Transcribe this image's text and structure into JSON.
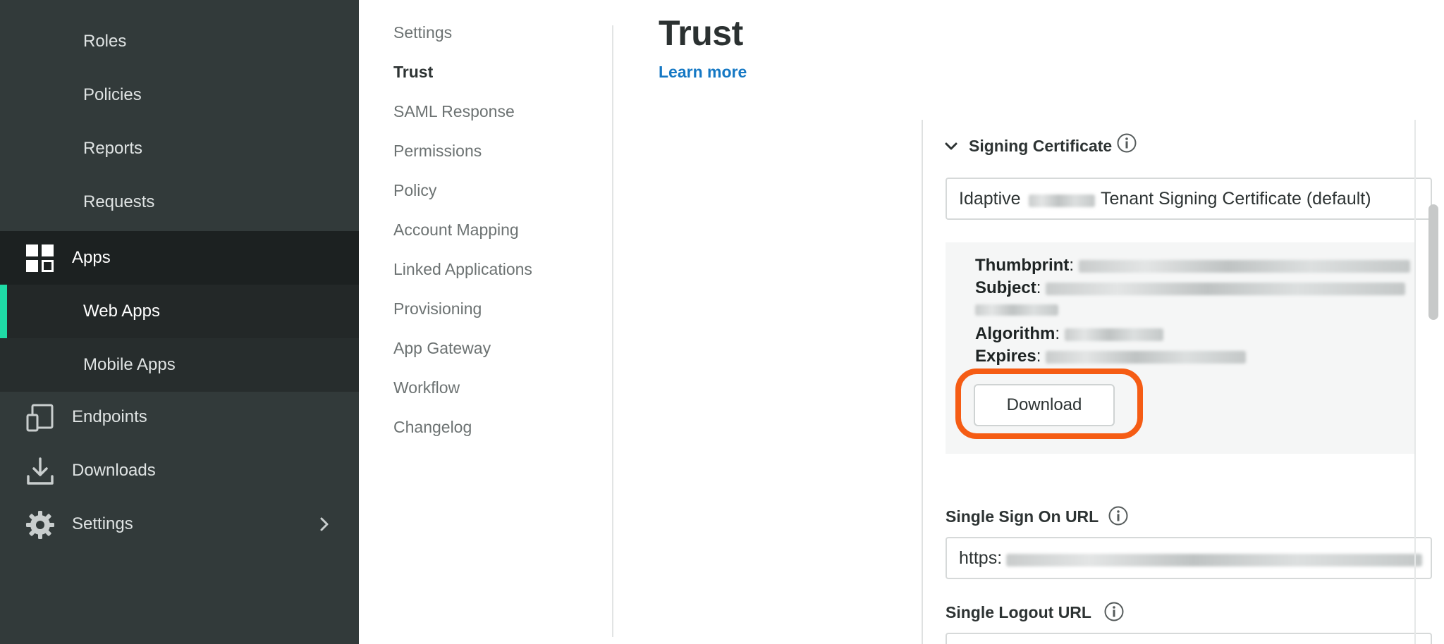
{
  "sidebar": {
    "items": [
      {
        "label": "Roles",
        "level": "sub"
      },
      {
        "label": "Policies",
        "level": "sub"
      },
      {
        "label": "Reports",
        "level": "sub"
      },
      {
        "label": "Requests",
        "level": "sub"
      },
      {
        "label": "Apps",
        "level": "top",
        "icon": "apps-grid-icon"
      },
      {
        "label": "Web Apps",
        "level": "sub",
        "active": true
      },
      {
        "label": "Mobile Apps",
        "level": "sub"
      },
      {
        "label": "Endpoints",
        "level": "top",
        "icon": "endpoints-icon"
      },
      {
        "label": "Downloads",
        "level": "top",
        "icon": "download-icon"
      },
      {
        "label": "Settings",
        "level": "top",
        "icon": "gear-icon"
      }
    ],
    "accent_color": "#1fdba6"
  },
  "subnav": {
    "items": [
      "Settings",
      "Trust",
      "SAML Response",
      "Permissions",
      "Policy",
      "Account Mapping",
      "Linked Applications",
      "Provisioning",
      "App Gateway",
      "Workflow",
      "Changelog"
    ],
    "current": "Trust"
  },
  "header": {
    "title": "Trust",
    "learn_more": "Learn more"
  },
  "signing_certificate": {
    "title": "Signing Certificate",
    "selected_prefix": "Idaptive",
    "selected_suffix": "Tenant Signing Certificate (default)",
    "details": {
      "thumbprint_label": "Thumbprint",
      "subject_label": "Subject",
      "algorithm_label": "Algorithm",
      "expires_label": "Expires"
    },
    "download_label": "Download",
    "highlight_color": "#f55c14"
  },
  "single_sign_on": {
    "label": "Single Sign On URL",
    "value_prefix": "https:"
  },
  "single_logout": {
    "label": "Single Logout URL"
  }
}
